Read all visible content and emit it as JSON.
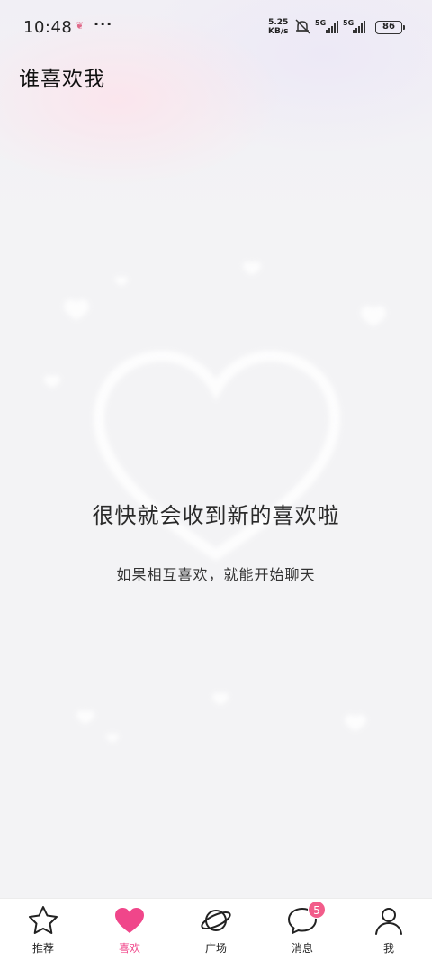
{
  "status_bar": {
    "time": "10:48",
    "dots": "···",
    "speed_value": "5.25",
    "speed_unit": "KB/s",
    "network1": "5G",
    "network2": "5G",
    "battery": "86"
  },
  "header": {
    "title": "谁喜欢我"
  },
  "empty_state": {
    "title": "很快就会收到新的喜欢啦",
    "subtitle": "如果相互喜欢，就能开始聊天"
  },
  "bottom_nav": {
    "items": [
      {
        "label": "推荐",
        "icon": "star-icon"
      },
      {
        "label": "喜欢",
        "icon": "heart-icon",
        "active": true
      },
      {
        "label": "广场",
        "icon": "planet-icon"
      },
      {
        "label": "消息",
        "icon": "message-bubble-icon",
        "badge": "5"
      },
      {
        "label": "我",
        "icon": "person-icon"
      }
    ]
  },
  "colors": {
    "accent": "#f0468a",
    "badge": "#f25c8a"
  }
}
